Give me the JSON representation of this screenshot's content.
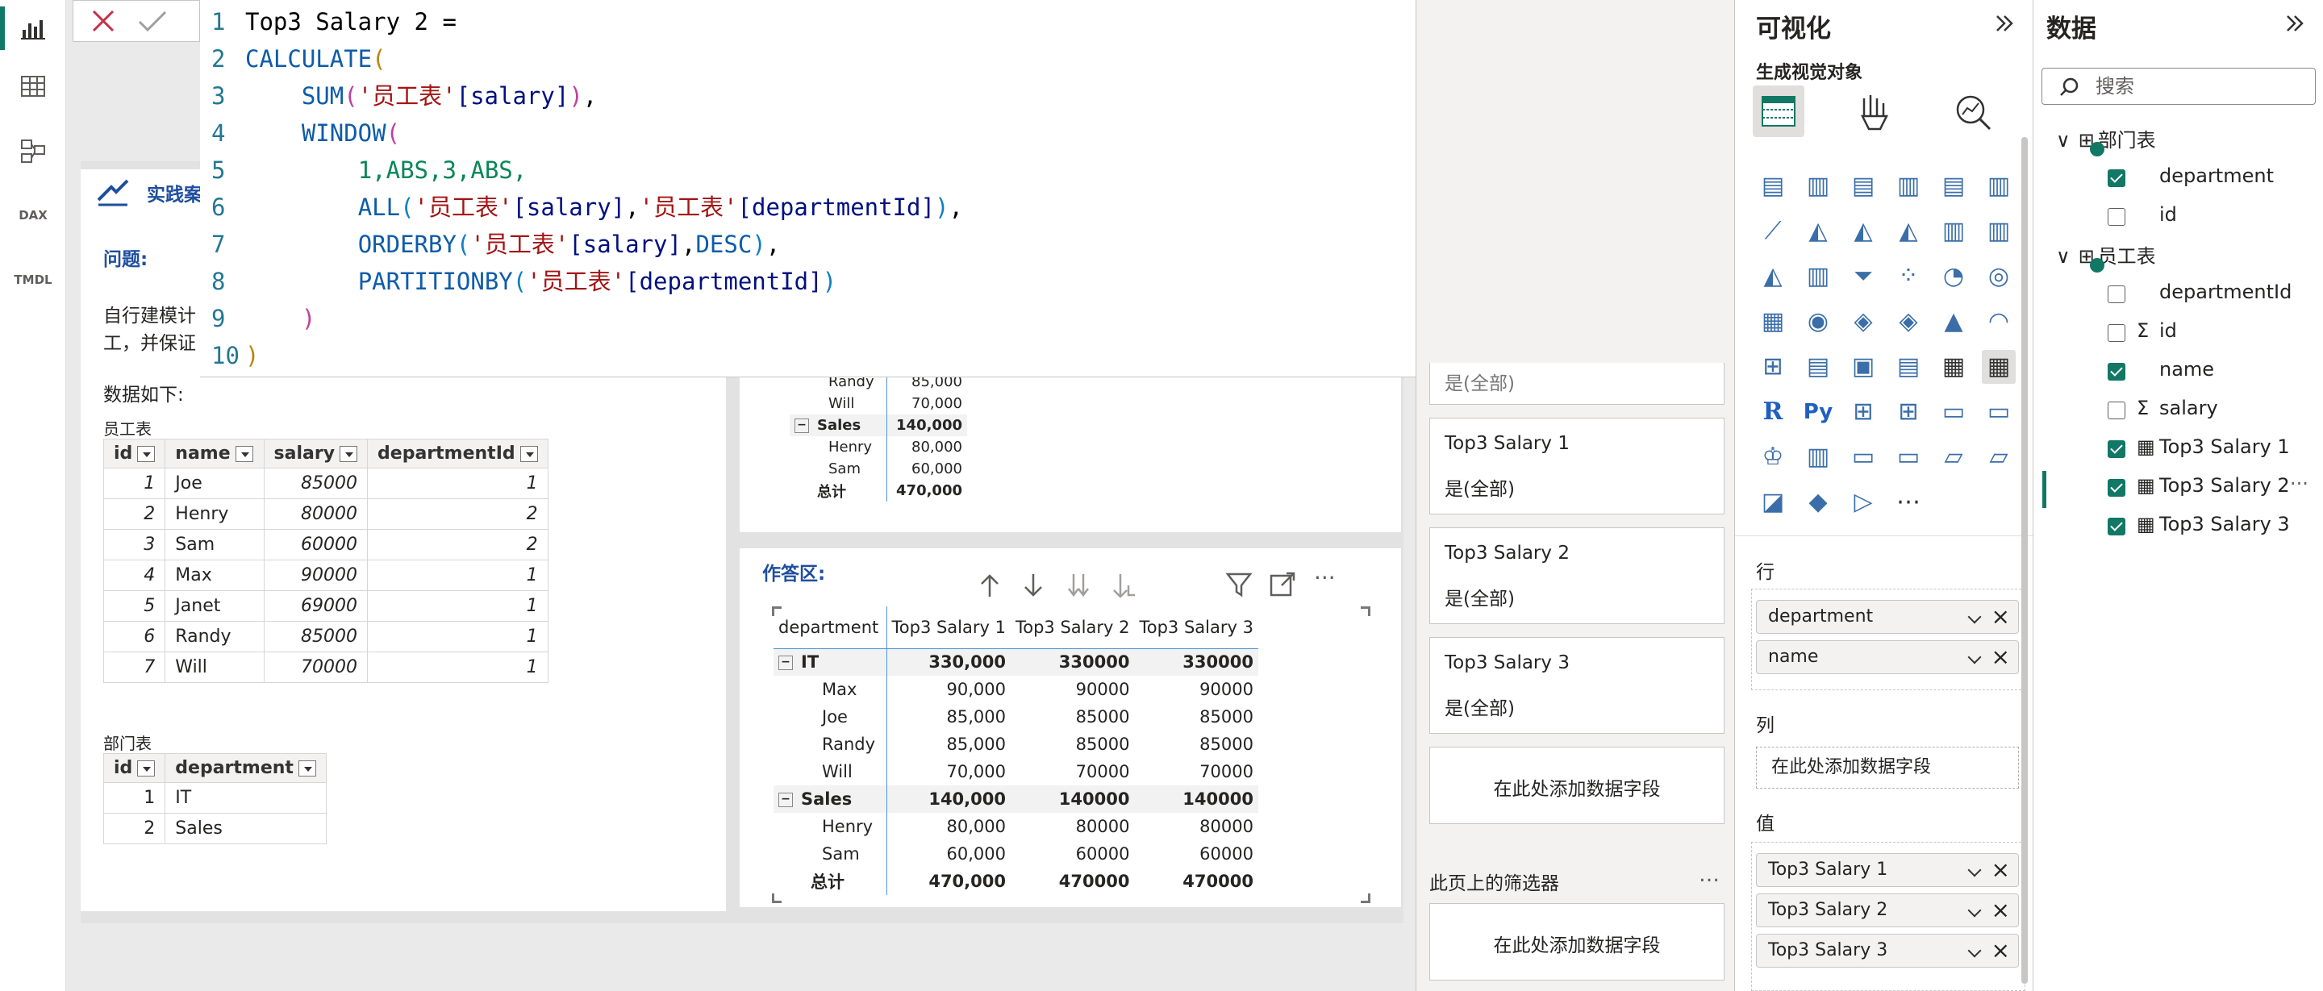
{
  "editor": {
    "lines": [
      "1",
      "2",
      "3",
      "4",
      "5",
      "6",
      "7",
      "8",
      "9",
      "10"
    ],
    "measure_name": "Top3 Salary 2",
    "eq": " =",
    "calculate": "CALCULATE",
    "sum": "SUM",
    "tbl": "'员工表'",
    "col_salary": "[salary]",
    "col_dept": "[departmentId]",
    "window": "WINDOW",
    "window_args": "1,ABS,3,ABS,",
    "all": "ALL",
    "orderby": "ORDERBY",
    "desc": "DESC",
    "partitionby": "PARTITIONBY"
  },
  "left_card": {
    "title_fragment": "实践案例",
    "question_label": "问题:",
    "desc_line1": "自行建模计",
    "desc_line2": "工，并保证",
    "data_label": "数据如下:",
    "emp_table_label": "员工表",
    "emp_headers": [
      "id",
      "name",
      "salary",
      "departmentId"
    ],
    "emp_rows": [
      [
        "1",
        "Joe",
        "85000",
        "1"
      ],
      [
        "2",
        "Henry",
        "80000",
        "2"
      ],
      [
        "3",
        "Sam",
        "60000",
        "2"
      ],
      [
        "4",
        "Max",
        "90000",
        "1"
      ],
      [
        "5",
        "Janet",
        "69000",
        "1"
      ],
      [
        "6",
        "Randy",
        "85000",
        "1"
      ],
      [
        "7",
        "Will",
        "70000",
        "1"
      ]
    ],
    "dept_table_label": "部门表",
    "dept_headers": [
      "id",
      "department"
    ],
    "dept_rows": [
      [
        "1",
        "IT"
      ],
      [
        "2",
        "Sales"
      ]
    ]
  },
  "mini_matrix": {
    "rows": [
      {
        "name": "Randy",
        "value": "85,000"
      },
      {
        "name": "Will",
        "value": "70,000"
      },
      {
        "name": "Sales",
        "value": "140,000",
        "group": true
      },
      {
        "name": "Henry",
        "value": "80,000"
      },
      {
        "name": "Sam",
        "value": "60,000"
      },
      {
        "name": "总计",
        "value": "470,000",
        "total": true
      }
    ]
  },
  "answer": {
    "label": "作答区:",
    "headers": [
      "department",
      "Top3 Salary 1",
      "Top3 Salary 2",
      "Top3 Salary 3"
    ],
    "rows": [
      {
        "name": "IT",
        "v1": "330,000",
        "v2": "330000",
        "v3": "330000",
        "group": true
      },
      {
        "name": "Max",
        "v1": "90,000",
        "v2": "90000",
        "v3": "90000"
      },
      {
        "name": "Joe",
        "v1": "85,000",
        "v2": "85000",
        "v3": "85000"
      },
      {
        "name": "Randy",
        "v1": "85,000",
        "v2": "85000",
        "v3": "85000"
      },
      {
        "name": "Will",
        "v1": "70,000",
        "v2": "70000",
        "v3": "70000"
      },
      {
        "name": "Sales",
        "v1": "140,000",
        "v2": "140000",
        "v3": "140000",
        "group": true
      },
      {
        "name": "Henry",
        "v1": "80,000",
        "v2": "80000",
        "v3": "80000"
      },
      {
        "name": "Sam",
        "v1": "60,000",
        "v2": "60000",
        "v3": "60000"
      },
      {
        "name": "总计",
        "v1": "470,000",
        "v2": "470000",
        "v3": "470000",
        "total": true
      }
    ]
  },
  "filters": {
    "partial_value": "是(全部)",
    "cards": [
      {
        "title": "Top3 Salary 1",
        "value": "是(全部)"
      },
      {
        "title": "Top3 Salary 2",
        "value": "是(全部)"
      },
      {
        "title": "Top3 Salary 3",
        "value": "是(全部)"
      }
    ],
    "add_field": "在此处添加数据字段",
    "page_filters_label": "此页上的筛选器",
    "more": "…"
  },
  "viz": {
    "title": "可视化",
    "subtitle": "生成视觉对象",
    "rows_label": "行",
    "rows_fields": [
      "department",
      "name"
    ],
    "cols_label": "列",
    "cols_placeholder": "在此处添加数据字段",
    "values_label": "值",
    "values_fields": [
      "Top3 Salary 1",
      "Top3 Salary 2",
      "Top3 Salary 3"
    ],
    "more": "···"
  },
  "data_pane": {
    "title": "数据",
    "search_placeholder": "搜索",
    "tables": [
      {
        "name": "部门表",
        "fields": [
          {
            "name": "department",
            "checked": true
          },
          {
            "name": "id",
            "checked": false
          }
        ]
      },
      {
        "name": "员工表",
        "fields": [
          {
            "name": "departmentId",
            "checked": false
          },
          {
            "name": "id",
            "checked": false,
            "sigma": true
          },
          {
            "name": "name",
            "checked": true
          },
          {
            "name": "salary",
            "checked": false,
            "sigma": true
          },
          {
            "name": "Top3 Salary 1",
            "checked": true,
            "measure": true
          },
          {
            "name": "Top3 Salary 2",
            "checked": true,
            "measure": true
          },
          {
            "name": "Top3 Salary 3",
            "checked": true,
            "measure": true
          }
        ]
      }
    ],
    "more": "···"
  },
  "rail": {
    "dax": "DAX",
    "tmdl": "TMDL"
  },
  "colors": {
    "accent": "#117865",
    "link": "#1f4e9f"
  }
}
